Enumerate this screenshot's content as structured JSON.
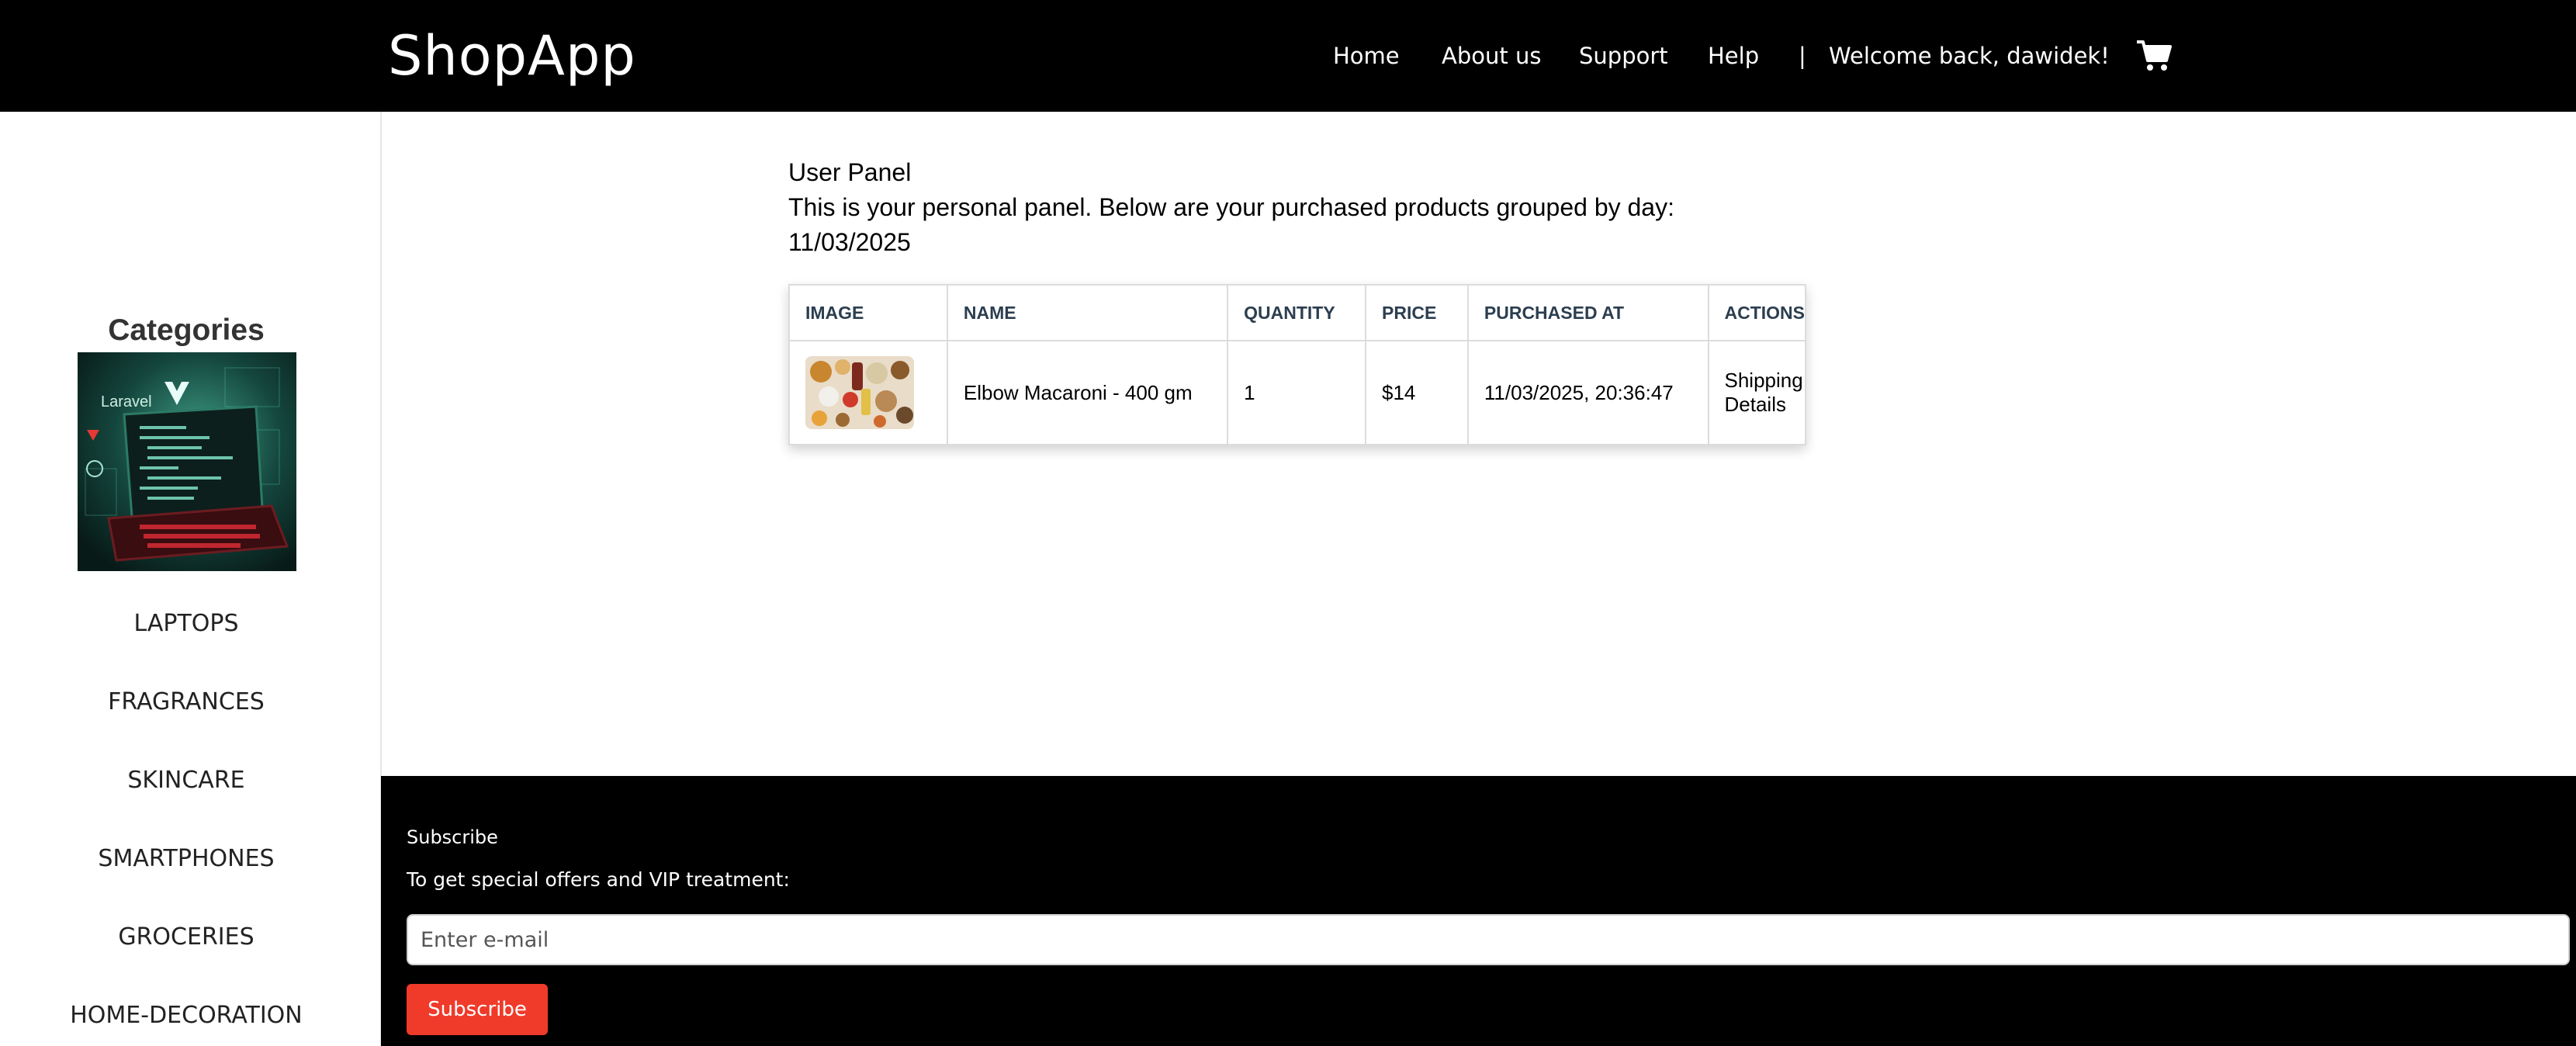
{
  "header": {
    "brand": "ShopApp",
    "nav": [
      "Home",
      "About us",
      "Support",
      "Help"
    ],
    "separator": "|",
    "welcome": "Welcome back, dawidek!",
    "cart_icon": "shopping-cart-icon"
  },
  "sidebar": {
    "title": "Categories",
    "image_icon": "laravel-vue-laptop-image",
    "items": [
      "LAPTOPS",
      "FRAGRANCES",
      "SKINCARE",
      "SMARTPHONES",
      "GROCERIES",
      "HOME-DECORATION"
    ]
  },
  "main": {
    "title": "User Panel",
    "description": "This is your personal panel. Below are your purchased products grouped by day:",
    "date": "11/03/2025",
    "table": {
      "headers": [
        "IMAGE",
        "NAME",
        "QUANTITY",
        "PRICE",
        "PURCHASED AT",
        "ACTIONS"
      ],
      "rows": [
        {
          "image": "groceries-product-image",
          "name": "Elbow Macaroni - 400 gm",
          "quantity": "1",
          "price": "$14",
          "purchased_at": "11/03/2025, 20:36:47",
          "action": "Shipping Details"
        }
      ]
    }
  },
  "footer": {
    "heading": "Subscribe",
    "text": "To get special offers and VIP treatment:",
    "email_placeholder": "Enter e-mail",
    "button_label": "Subscribe"
  },
  "colors": {
    "header_bg": "#000000",
    "footer_bg": "#000000",
    "subscribe_button": "#f03a2a"
  }
}
